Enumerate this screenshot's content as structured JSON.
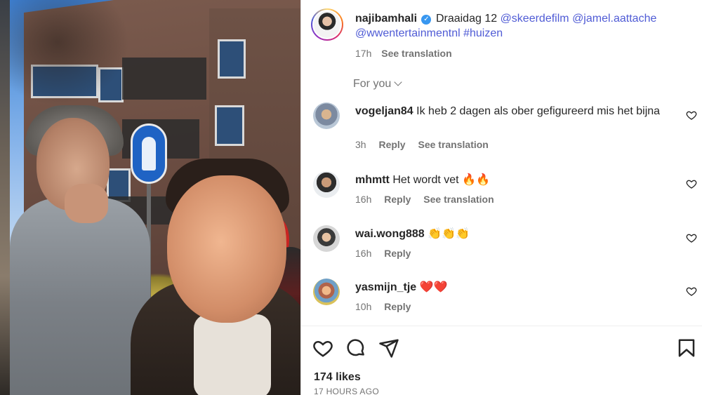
{
  "post": {
    "username": "najibamhali",
    "caption_text": "Draaidag 12",
    "mentions": [
      "@skeerdefilm",
      "@jamel.aattache",
      "@wwentertainmentnl",
      "#huizen"
    ],
    "time": "17h",
    "see_translation": "See translation",
    "verified_icon": "verified-check-icon"
  },
  "filter": {
    "label": "For you"
  },
  "comments": [
    {
      "username": "vogeljan84",
      "text": "Ik heb 2 dagen als ober gefigureerd mis het bijna",
      "time": "3h",
      "reply": "Reply",
      "translate": "See translation"
    },
    {
      "username": "mhmtt",
      "text": "Het wordt vet 🔥🔥",
      "time": "16h",
      "reply": "Reply",
      "translate": "See translation"
    },
    {
      "username": "wai.wong888",
      "text": "👏👏👏",
      "time": "16h",
      "reply": "Reply"
    },
    {
      "username": "yasmijn_tje",
      "text": "❤️❤️",
      "time": "10h",
      "reply": "Reply"
    }
  ],
  "actions": {
    "icons": [
      "heart-icon",
      "comment-icon",
      "share-icon",
      "bookmark-icon"
    ]
  },
  "stats": {
    "likes": "174 likes",
    "posted": "17 hours ago"
  },
  "colors": {
    "link": "#4f5bd5",
    "muted": "#737373",
    "verified": "#3897f0"
  }
}
